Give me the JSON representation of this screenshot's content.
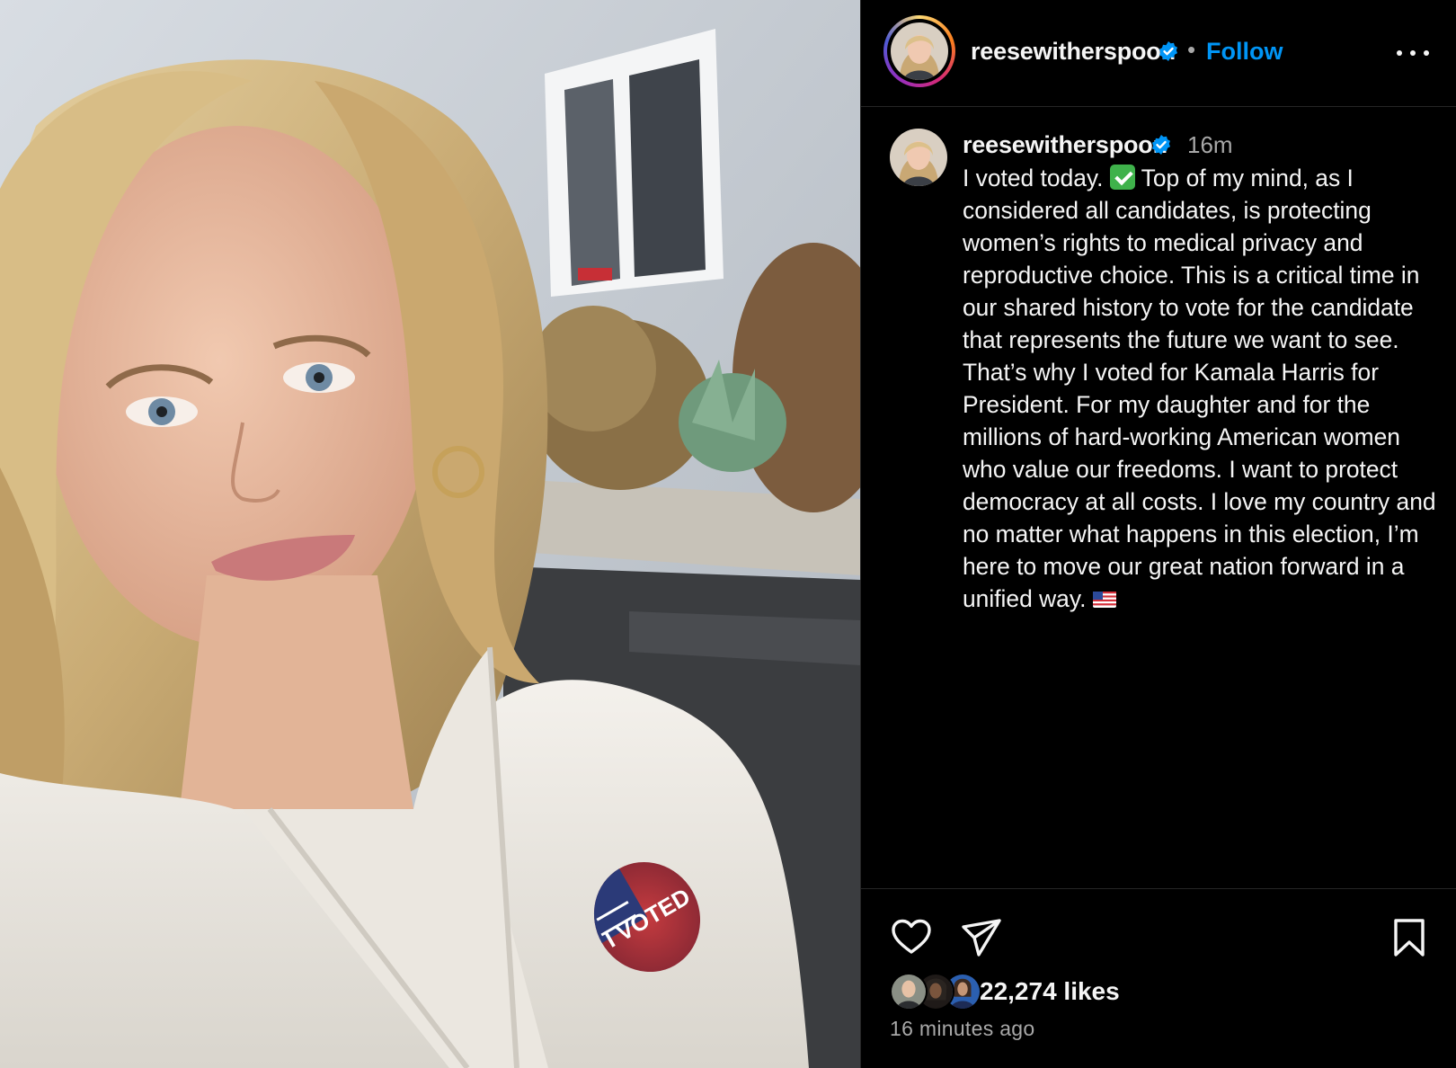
{
  "header": {
    "username": "reesewitherspoon",
    "separator": "•",
    "follow_label": "Follow"
  },
  "caption": {
    "username": "reesewitherspoon",
    "time": "16m",
    "text_part1": "I voted today. ",
    "text_part2": " Top of my mind, as I considered all candidates, is protecting women’s rights to medical privacy and reproductive choice. This is a critical time in our shared history to vote for the candidate that represents the future we want to see. That’s why I voted for Kamala Harris for President. For my daughter and for the millions of hard-working American women who value our freedoms. I want to protect democracy at all costs. I love my country and no matter what happens in this election, I’m here to move our great nation forward in a unified way. ",
    "emoji_1": "check-mark-button-emoji",
    "emoji_2": "us-flag-emoji"
  },
  "media": {
    "sticker_text": "I VOTED"
  },
  "actions": {
    "like_icon": "heart-icon",
    "share_icon": "paper-plane-icon",
    "save_icon": "bookmark-icon"
  },
  "likes": {
    "count": "22,274",
    "suffix": "likes"
  },
  "timestamp": "16 minutes ago",
  "colors": {
    "accent": "#0095f6",
    "verified": "#0095f6",
    "background": "#000000",
    "secondary_text": "#a8a8a8",
    "divider": "#262626"
  }
}
